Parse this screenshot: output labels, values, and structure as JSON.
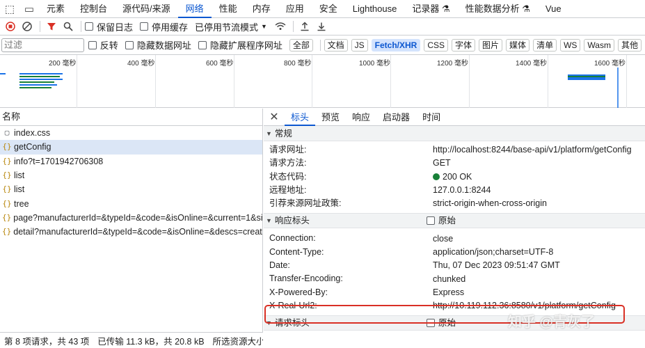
{
  "tabs": [
    {
      "label": "元素"
    },
    {
      "label": "控制台"
    },
    {
      "label": "源代码/来源"
    },
    {
      "label": "网络"
    },
    {
      "label": "性能"
    },
    {
      "label": "内存"
    },
    {
      "label": "应用"
    },
    {
      "label": "安全"
    },
    {
      "label": "Lighthouse"
    },
    {
      "label": "记录器 ⚗"
    },
    {
      "label": "性能数据分析 ⚗"
    },
    {
      "label": "Vue"
    }
  ],
  "toolbar": {
    "preserve_log": "保留日志",
    "disable_cache": "停用缓存",
    "throttle": "已停用节流模式"
  },
  "filter": {
    "placeholder": "过滤",
    "invert": "反转",
    "hide_data_urls": "隐藏数据网址",
    "hide_ext_urls": "隐藏扩展程序网址",
    "types": [
      "全部",
      "文档",
      "JS",
      "Fetch/XHR",
      "CSS",
      "字体",
      "图片",
      "媒体",
      "清单",
      "WS",
      "Wasm",
      "其他"
    ]
  },
  "timeline": {
    "ticks": [
      "200 毫秒",
      "400 毫秒",
      "600 毫秒",
      "800 毫秒",
      "1000 毫秒",
      "1200 毫秒",
      "1400 毫秒",
      "1600 毫秒"
    ]
  },
  "requests": {
    "header": "名称",
    "rows": [
      {
        "icon": "▢",
        "name": "index.css"
      },
      {
        "icon": "{}",
        "name": "getConfig"
      },
      {
        "icon": "{}",
        "name": "info?t=1701942706308"
      },
      {
        "icon": "{}",
        "name": "list"
      },
      {
        "icon": "{}",
        "name": "list"
      },
      {
        "icon": "{}",
        "name": "tree"
      },
      {
        "icon": "{}",
        "name": "page?manufacturerId=&typeId=&code=&isOnline=&current=1&siz…"
      },
      {
        "icon": "{}",
        "name": "detail?manufacturerId=&typeId=&code=&isOnline=&descs=create…"
      }
    ]
  },
  "detail": {
    "tabs": [
      "标头",
      "预览",
      "响应",
      "启动器",
      "时间"
    ],
    "general": {
      "title": "常规",
      "rows": [
        {
          "k": "请求网址:",
          "v": "http://localhost:8244/base-api/v1/platform/getConfig"
        },
        {
          "k": "请求方法:",
          "v": "GET"
        },
        {
          "k": "状态代码:",
          "v": "200 OK"
        },
        {
          "k": "远程地址:",
          "v": "127.0.0.1:8244"
        },
        {
          "k": "引荐来源网址政策:",
          "v": "strict-origin-when-cross-origin"
        }
      ]
    },
    "response_headers": {
      "title": "响应标头",
      "raw": "原始",
      "rows": [
        {
          "k": "Connection:",
          "v": "close"
        },
        {
          "k": "Content-Type:",
          "v": "application/json;charset=UTF-8"
        },
        {
          "k": "Date:",
          "v": "Thu, 07 Dec 2023 09:51:47 GMT"
        },
        {
          "k": "Transfer-Encoding:",
          "v": "chunked"
        },
        {
          "k": "X-Powered-By:",
          "v": "Express"
        },
        {
          "k": "X-Real-Url2:",
          "v": "http://10.119.112.36:8580/v1/platform/getConfig"
        }
      ]
    },
    "request_headers": {
      "title": "请求标头",
      "raw": "原始"
    }
  },
  "status": {
    "requests": "第 8 项请求，共 43 项",
    "transferred": "已传输 11.3 kB，共 20.8 kB",
    "resources": "所选资源大小为"
  },
  "watermark": "知乎 @青灰了",
  "colors": {
    "accent": "#0b57d0",
    "highlight": "#d93025",
    "status_ok": "#188038"
  }
}
